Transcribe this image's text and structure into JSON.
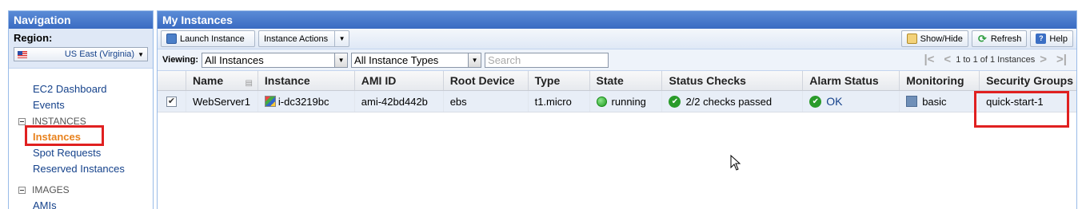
{
  "nav": {
    "title": "Navigation",
    "region_label": "Region:",
    "region_value": "US East (Virginia)",
    "dashboard": "EC2 Dashboard",
    "events": "Events",
    "section_instances": "INSTANCES",
    "instances": "Instances",
    "spot_requests": "Spot Requests",
    "reserved_instances": "Reserved Instances",
    "section_images": "IMAGES",
    "amis": "AMIs"
  },
  "main": {
    "title": "My Instances",
    "toolbar": {
      "launch": "Launch Instance",
      "actions": "Instance Actions",
      "show_hide": "Show/Hide",
      "refresh": "Refresh",
      "help": "Help"
    },
    "filter": {
      "viewing_label": "Viewing:",
      "view_select": "All Instances",
      "type_select": "All Instance Types",
      "search_placeholder": "Search",
      "pager_text": "1 to 1 of 1 Instances"
    },
    "columns": [
      "Name",
      "Instance",
      "AMI ID",
      "Root Device",
      "Type",
      "State",
      "Status Checks",
      "Alarm Status",
      "Monitoring",
      "Security Groups"
    ],
    "row": {
      "selected": true,
      "name": "WebServer1",
      "instance": "i-dc3219bc",
      "ami": "ami-42bd442b",
      "root_device": "ebs",
      "type": "t1.micro",
      "state": "running",
      "status_checks": "2/2 checks passed",
      "alarm_status": "OK",
      "monitoring": "basic",
      "security_groups": "quick-start-1"
    }
  },
  "colors": {
    "header_blue": "#3a6bc2",
    "link_blue": "#15428b",
    "active_orange": "#e8821e",
    "highlight_red": "#e02020",
    "status_green": "#1d9a1d"
  }
}
